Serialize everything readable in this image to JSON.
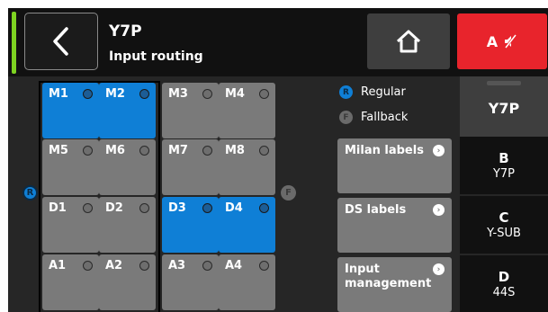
{
  "header": {
    "device_name": "Y7P",
    "page_title": "Input routing",
    "mute_label": "A"
  },
  "icons": {
    "back": "chevron-left-icon",
    "home": "home-icon",
    "mute": "speaker-muted-icon"
  },
  "colors": {
    "active_cell": "#0f7fd6",
    "inactive_cell": "#7a7a7a",
    "mute_button": "#e8242c",
    "status_bar": "#7ed321"
  },
  "grid": {
    "rows": [
      [
        {
          "label": "M1",
          "active": true
        },
        {
          "label": "M2",
          "active": true
        },
        {
          "label": "M3",
          "active": false
        },
        {
          "label": "M4",
          "active": false
        }
      ],
      [
        {
          "label": "M5",
          "active": false
        },
        {
          "label": "M6",
          "active": false
        },
        {
          "label": "M7",
          "active": false
        },
        {
          "label": "M8",
          "active": false
        }
      ],
      [
        {
          "label": "D1",
          "active": false
        },
        {
          "label": "D2",
          "active": false
        },
        {
          "label": "D3",
          "active": true
        },
        {
          "label": "D4",
          "active": true
        }
      ],
      [
        {
          "label": "A1",
          "active": false
        },
        {
          "label": "A2",
          "active": false
        },
        {
          "label": "A3",
          "active": false
        },
        {
          "label": "A4",
          "active": false
        }
      ]
    ],
    "regular_marker": "R",
    "fallback_marker": "F"
  },
  "legend": {
    "regular": {
      "badge": "R",
      "label": "Regular"
    },
    "fallback": {
      "badge": "F",
      "label": "Fallback"
    }
  },
  "actions": {
    "milan_labels": "Milan labels",
    "ds_labels": "DS labels",
    "input_management_1": "Input",
    "input_management_2": "management"
  },
  "channels": {
    "selected": {
      "name": "Y7P"
    },
    "list": [
      {
        "letter": "B",
        "name": "Y7P"
      },
      {
        "letter": "C",
        "name": "Y-SUB"
      },
      {
        "letter": "D",
        "name": "44S"
      }
    ]
  }
}
